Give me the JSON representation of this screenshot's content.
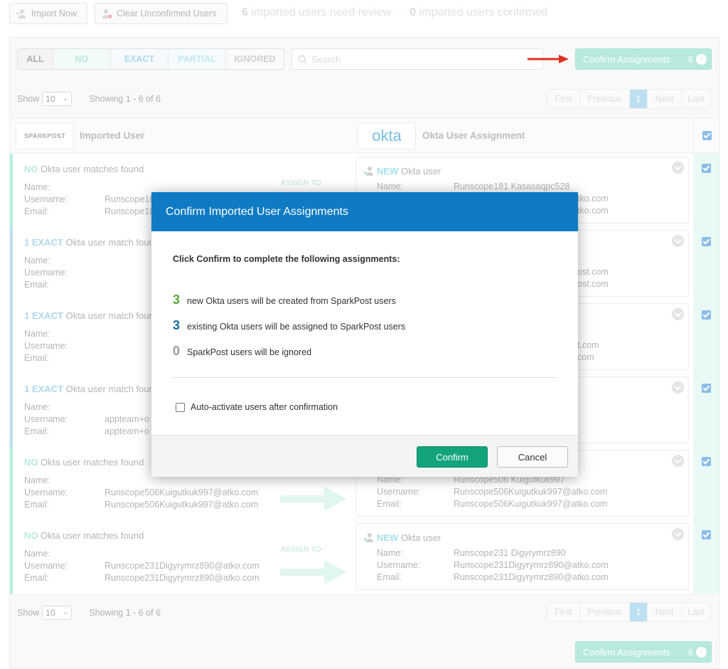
{
  "toolbar": {
    "import_label": "Import Now",
    "clear_label": "Clear Unconfirmed Users",
    "review_count": "6",
    "review_text": "imported users need review",
    "confirmed_count": "0",
    "confirmed_text": "imported users confirmed"
  },
  "filters": [
    "ALL",
    "NO",
    "EXACT",
    "PARTIAL",
    "IGNORED"
  ],
  "search": {
    "placeholder": "Search"
  },
  "confirm_assignments": {
    "label": "Confirm Assignments",
    "count": "6"
  },
  "pagination": {
    "show_label": "Show",
    "page_size": "10",
    "showing_text": "Showing 1 - 6 of 6",
    "buttons": [
      "First",
      "Previous",
      "1",
      "Next",
      "Last"
    ]
  },
  "table": {
    "left_logo": "SPARKPOST",
    "left_title": "Imported User",
    "right_logo": "okta",
    "right_title": "Okta User Assignment"
  },
  "field_labels": {
    "name": "Name:",
    "username": "Username:",
    "email": "Email:"
  },
  "assign_to_label": "ASSIGN TO",
  "rows": [
    {
      "match_strong": "NO",
      "match_rest": "Okta user matches found",
      "username": "Runscope18",
      "email": "Runscope18",
      "okta_new": "NEW",
      "okta_new_rest": "Okta user",
      "okta_name": "Runscope181 Kasasaqpc528",
      "okta_username": "tko.com",
      "okta_email": "tko.com"
    },
    {
      "match_strong": "1 EXACT",
      "match_rest": "Okta user match foun",
      "okta_username": "ost.com",
      "okta_email": "ost.com"
    },
    {
      "match_strong": "1 EXACT",
      "match_rest": "Okta user match foun",
      "okta_username": "t.com",
      "okta_email": "com"
    },
    {
      "match_strong": "1 EXACT",
      "match_rest": "Okta user match foun",
      "username": "appteam+o",
      "email": "appteam+o"
    },
    {
      "match_strong": "NO",
      "match_rest": "Okta user matches found",
      "username": "Runscope506Kuigutkuk997@atko.com",
      "email": "Runscope506Kuigutkuk997@atko.com",
      "okta_name": "Runscope506 Kuigutkuk997",
      "okta_username": "Runscope506Kuigutkuk997@atko.com",
      "okta_email": "Runscope506Kuigutkuk997@atko.com"
    },
    {
      "match_strong": "NO",
      "match_rest": "Okta user matches found",
      "username": "Runscope231Digyrymrz890@atko.com",
      "email": "Runscope231Digyrymrz890@atko.com",
      "okta_new": "NEW",
      "okta_new_rest": "Okta user",
      "okta_name": "Runscope231 Digyrymrz890",
      "okta_username": "Runscope231Digyrymrz890@atko.com",
      "okta_email": "Runscope231Digyrymrz890@atko.com"
    }
  ],
  "modal": {
    "title": "Confirm Imported User Assignments",
    "intro": "Click Confirm to complete the following assignments:",
    "lines": [
      {
        "num": "3",
        "text": "new Okta users will be created from SparkPost users",
        "color": "#5aa63a"
      },
      {
        "num": "3",
        "text": "existing Okta users will be assigned to SparkPost users",
        "color": "#1a6e9e"
      },
      {
        "num": "0",
        "text": "SparkPost users will be ignored",
        "color": "#9a9a9a"
      }
    ],
    "auto_activate": "Auto-activate users after confirmation",
    "confirm": "Confirm",
    "cancel": "Cancel"
  },
  "colors": {
    "accent_teal": "#7ed8c2",
    "okta_blue": "#0f7bc4",
    "confirm_green": "#13a47e",
    "row_no_bar": "#7fe0c8",
    "row_exact_bar": "#86c6e6"
  }
}
